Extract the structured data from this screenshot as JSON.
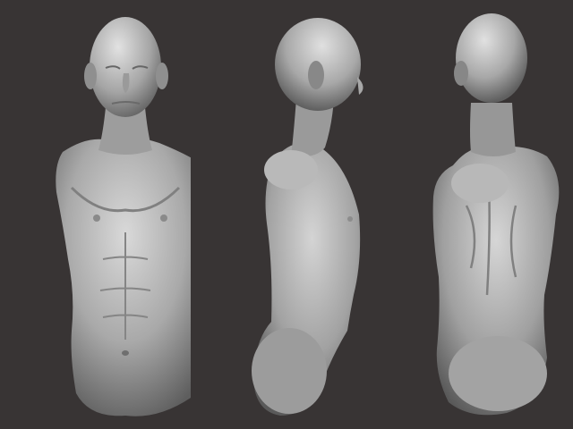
{
  "scene": {
    "background_color": "#383434",
    "material_color": "#b8b8b8",
    "views": [
      {
        "id": "front",
        "subject": "male-torso-bust",
        "orientation": "front"
      },
      {
        "id": "side",
        "subject": "male-torso-bust",
        "orientation": "right-profile"
      },
      {
        "id": "back",
        "subject": "male-torso-bust",
        "orientation": "back-three-quarter"
      }
    ]
  }
}
